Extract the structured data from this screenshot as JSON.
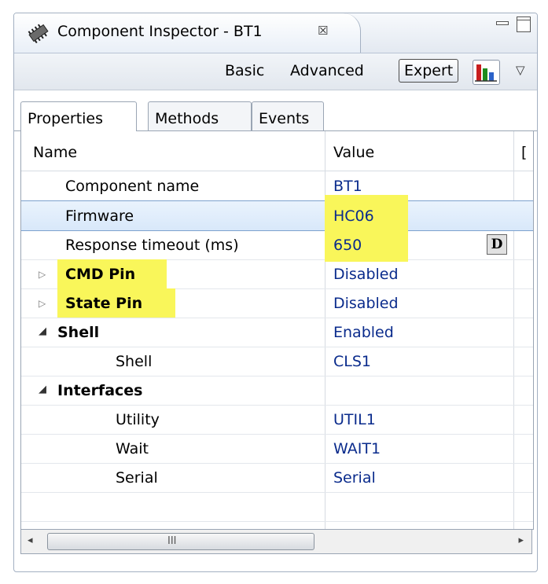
{
  "titlebar": {
    "title": "Component Inspector - BT1",
    "close_glyph": "☒"
  },
  "toolbar": {
    "basic": "Basic",
    "advanced": "Advanced",
    "expert": "Expert",
    "menu_glyph": "▽"
  },
  "tabs": [
    {
      "label": "Properties"
    },
    {
      "label": "Methods"
    },
    {
      "label": "Events"
    }
  ],
  "table": {
    "header_name": "Name",
    "header_value": "Value",
    "header_third": "[",
    "rows": [
      {
        "name": "Component name",
        "value": "BT1"
      },
      {
        "name": "Firmware",
        "value": "HC06"
      },
      {
        "name": "Response timeout (ms)",
        "value": "650",
        "button": "D"
      },
      {
        "name": "CMD Pin",
        "value": "Disabled"
      },
      {
        "name": "State Pin",
        "value": "Disabled"
      },
      {
        "name": "Shell",
        "value": "Enabled"
      },
      {
        "name": "Shell",
        "value": "CLS1"
      },
      {
        "name": "Interfaces",
        "value": ""
      },
      {
        "name": "Utility",
        "value": "UTIL1"
      },
      {
        "name": "Wait",
        "value": "WAIT1"
      },
      {
        "name": "Serial",
        "value": "Serial"
      }
    ]
  },
  "scrollbar": {
    "left_glyph": "◂",
    "right_glyph": "▸",
    "grip": "III"
  },
  "colors": {
    "highlight": "#f9f65a",
    "value_text": "#0a2b8c",
    "selection": "#d8e8fa"
  }
}
